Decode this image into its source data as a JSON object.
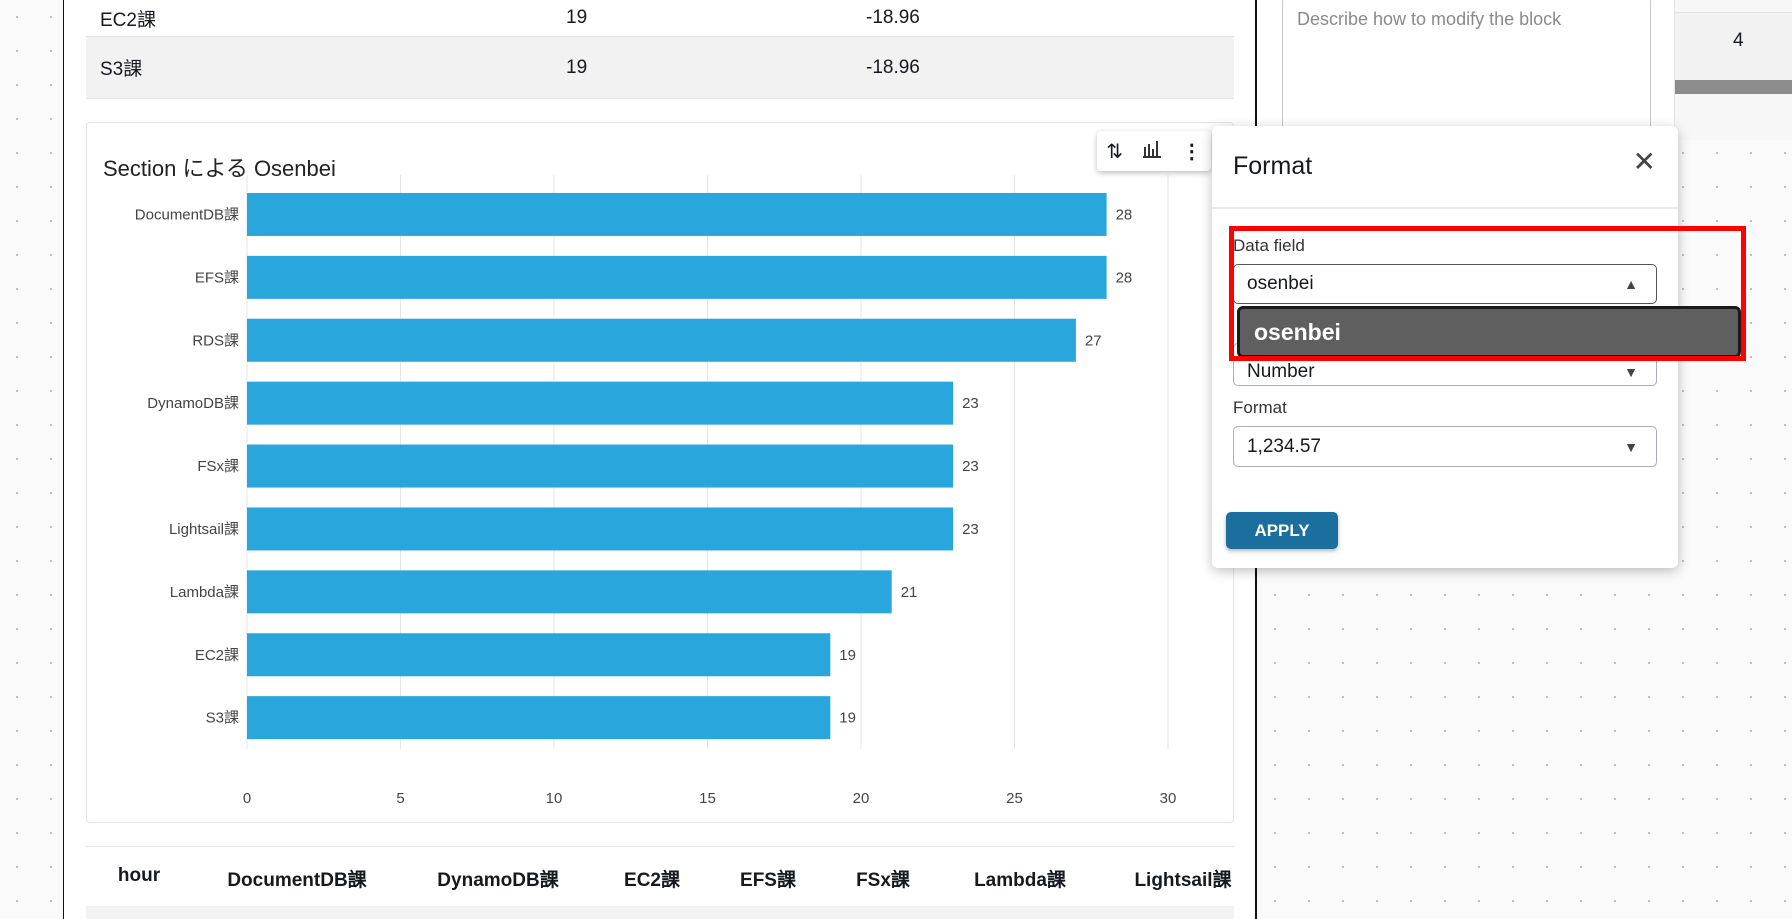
{
  "top_table": {
    "rows": [
      {
        "section": "EC2課",
        "value": "19",
        "diff": "-18.96"
      },
      {
        "section": "S3課",
        "value": "19",
        "diff": "-18.96"
      }
    ]
  },
  "chart_data": {
    "type": "bar",
    "orientation": "horizontal",
    "title": "Section による Osenbei",
    "categories": [
      "DocumentDB課",
      "EFS課",
      "RDS課",
      "DynamoDB課",
      "FSx課",
      "Lightsail課",
      "Lambda課",
      "EC2課",
      "S3課"
    ],
    "values": [
      28,
      28,
      27,
      23,
      23,
      23,
      21,
      19,
      19
    ],
    "xlim": [
      0,
      30
    ],
    "xticks": [
      "0",
      "5",
      "10",
      "15",
      "20",
      "25",
      "30"
    ],
    "grid": true,
    "bar_color": "#29a6db"
  },
  "toolbar": {
    "icons": [
      "sort-icon",
      "chart-type-icon",
      "more-vertical-icon"
    ]
  },
  "bottom_table": {
    "headers": [
      "hour",
      "DocumentDB課",
      "DynamoDB課",
      "EC2課",
      "EFS課",
      "FSx課",
      "Lambda課",
      "Lightsail課"
    ]
  },
  "prompt": {
    "placeholder": "Describe how to modify the block"
  },
  "side_value": "4",
  "format_panel": {
    "title": "Format",
    "data_field_label": "Data field",
    "data_field_value": "osenbei",
    "dropdown_option": "osenbei",
    "type_value": "Number",
    "format_label": "Format",
    "format_value": "1,234.57",
    "apply_label": "APPLY",
    "highlight_color": "#ff0000"
  }
}
